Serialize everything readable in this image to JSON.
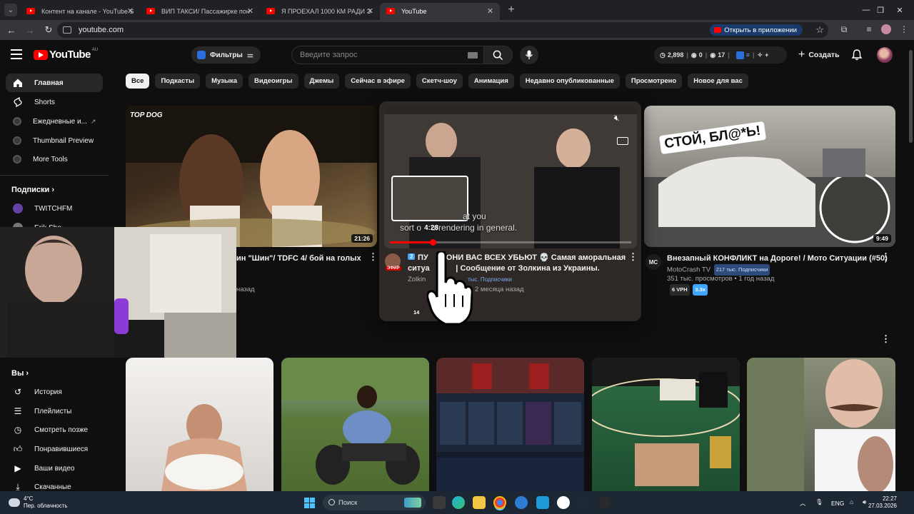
{
  "browser": {
    "tabs": [
      {
        "title": "Контент на канале - YouTube S",
        "active": false
      },
      {
        "title": "ВИП ТАКСИ/ Пассажирке пон",
        "active": false
      },
      {
        "title": "Я ПРОЕХАЛ 1000 КМ РАДИ Э",
        "active": false
      },
      {
        "title": "YouTube",
        "active": true
      }
    ],
    "url": "youtube.com",
    "open_in_app": "Открыть в приложении"
  },
  "masthead": {
    "logo_text": "YouTube",
    "country_code": "AU",
    "filters_label": "Фильтры",
    "search_placeholder": "Введите запрос",
    "stats": {
      "views": "2,898",
      "zero": "0",
      "count": "17"
    },
    "create_label": "Создать"
  },
  "sidebar": {
    "items": [
      {
        "label": "Главная",
        "icon": "home-icon",
        "active": true
      },
      {
        "label": "Shorts",
        "icon": "shorts-icon"
      },
      {
        "label": "Ежедневные и...",
        "icon": "extension-icon",
        "external": "↗"
      },
      {
        "label": "Thumbnail Preview",
        "icon": "extension-icon"
      },
      {
        "label": "More Tools",
        "icon": "extension-icon"
      }
    ],
    "subscriptions_title": "Подписки",
    "subscriptions": [
      {
        "label": "TWITCHFM"
      },
      {
        "label": "Erik Sho"
      }
    ],
    "you_title": "Вы",
    "you_items": [
      {
        "label": "История",
        "icon": "history-icon"
      },
      {
        "label": "Плейлисты",
        "icon": "playlists-icon"
      },
      {
        "label": "Смотреть позже",
        "icon": "watch-later-icon"
      },
      {
        "label": "Понравившиеся",
        "icon": "like-icon"
      },
      {
        "label": "Ваши видео",
        "icon": "your-videos-icon"
      },
      {
        "label": "Скачанные",
        "icon": "download-icon"
      }
    ]
  },
  "chips": [
    "Все",
    "Подкасты",
    "Музыка",
    "Видеоигры",
    "Джемы",
    "Сейчас в эфире",
    "Скетч-шоу",
    "Анимация",
    "Недавно опубликованные",
    "Просмотрено",
    "Новое для вас"
  ],
  "videos": [
    {
      "title": "ин \"Шин\"/ TDFC 4/ бой на голых",
      "meta2": "назад",
      "duration": "21:26",
      "thumb_text": "TOP DOG"
    },
    {
      "title_line1": "ПУ     о ОНИ ВАС ВСЕХ УБЬЮТ 💀 Самая аморальная",
      "title_line2": "ситуа            | Сообщение от Золкина из Украины.",
      "channel": "Zolkin",
      "subs": "тыс. Подписчики",
      "meta2": "2 месяца назад",
      "views_badge": "14",
      "num_badge": "2",
      "live_badge": "ЭФИР",
      "subtitle_line1": "at you",
      "subtitle_line2": "sort o    urrendering in general.",
      "hover_time": "4:28",
      "progress": 0.18
    },
    {
      "title": "Внезапный КОНФЛИКТ на Дороге! / Мото Ситуации (#50)",
      "channel": "MotoCrash TV",
      "subs_badge": "217 тыс. Подписчики",
      "meta": "351 тыс. просмотров • 1 год назад",
      "vph": "6 VPH",
      "ratio": "3.3x",
      "duration": "9:49",
      "thumb_text": "СТОЙ, БЛ@*Ь!"
    }
  ],
  "taskbar": {
    "weather_temp": "4°C",
    "weather_desc": "Пер. облачность",
    "search_label": "Поиск",
    "lang": "ENG",
    "time": "22:27",
    "date": "27.03.2026"
  },
  "colors": {
    "yt_red": "#ff0000",
    "accent_blue": "#3ea6ff",
    "bg": "#0f0f0f"
  }
}
